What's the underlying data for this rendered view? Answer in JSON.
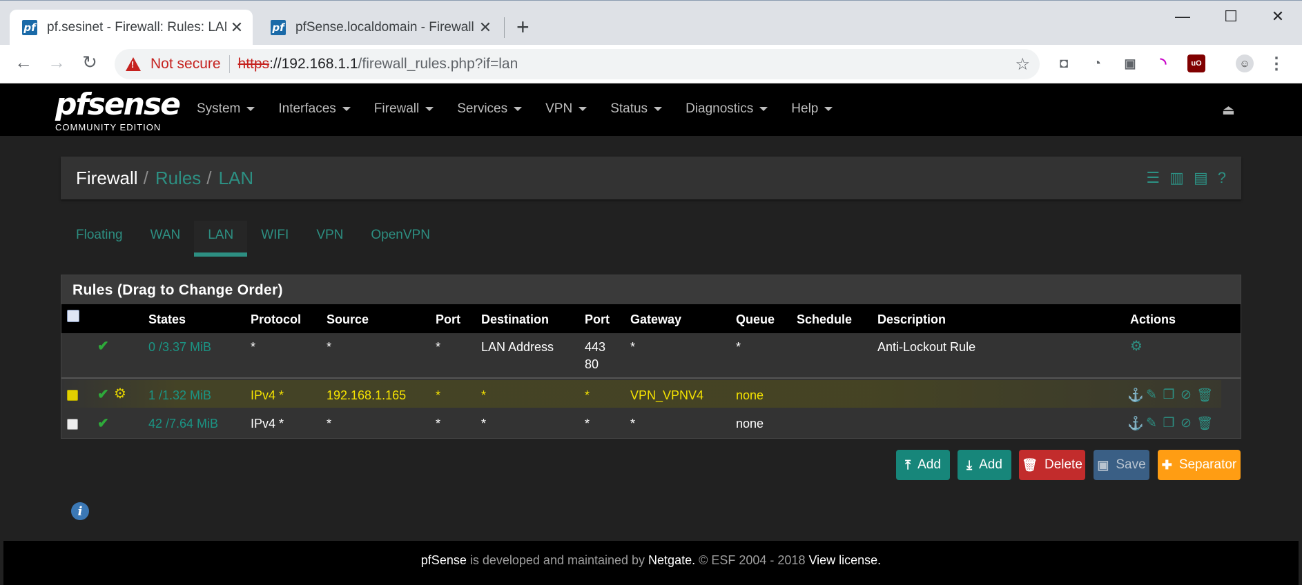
{
  "browser": {
    "tabs": [
      {
        "title": "pf.sesinet - Firewall: Rules: LAN",
        "favicon": "pf"
      },
      {
        "title": "pfSense.localdomain - Firewall: N",
        "favicon": "pf"
      }
    ],
    "new_tab": "+",
    "window": {
      "minimize": "—",
      "maximize": "☐",
      "close": "✕"
    },
    "nav": {
      "back": "←",
      "forward": "→",
      "reload": "↻"
    },
    "security_label": "Not secure",
    "url": {
      "scheme": "https",
      "host": "://192.168.1.1",
      "path": "/firewall_rules.php?if=lan"
    },
    "star": "☆",
    "menu": "⋮"
  },
  "pf_nav": {
    "logo": "pfsense",
    "logo_sub": "COMMUNITY EDITION",
    "items": [
      "System",
      "Interfaces",
      "Firewall",
      "Services",
      "VPN",
      "Status",
      "Diagnostics",
      "Help"
    ],
    "logout": "⏏"
  },
  "breadcrumb": {
    "root": "Firewall",
    "sep": "/",
    "level1": "Rules",
    "level2": "LAN"
  },
  "interface_tabs": [
    "Floating",
    "WAN",
    "LAN",
    "WIFI",
    "VPN",
    "OpenVPN"
  ],
  "rules_panel": {
    "title": "Rules (Drag to Change Order)",
    "headers": [
      "States",
      "Protocol",
      "Source",
      "Port",
      "Destination",
      "Port",
      "Gateway",
      "Queue",
      "Schedule",
      "Description",
      "Actions"
    ],
    "rows": [
      {
        "states": "0 /3.37 MiB",
        "protocol": "*",
        "source": "*",
        "sport": "*",
        "destination": "LAN Address",
        "dport_1": "443",
        "dport_2": "80",
        "gateway": "*",
        "queue": "*",
        "schedule": "",
        "description": "Anti-Lockout Rule"
      },
      {
        "states": "1 /1.32 MiB",
        "protocol": "IPv4 *",
        "source": "192.168.1.165",
        "sport": "*",
        "destination": "*",
        "dport_1": "*",
        "gateway": "VPN_VPNV4",
        "queue": "none",
        "schedule": "",
        "description": ""
      },
      {
        "states": "42 /7.64 MiB",
        "protocol": "IPv4 *",
        "source": "*",
        "sport": "*",
        "destination": "*",
        "dport_1": "*",
        "gateway": "*",
        "queue": "none",
        "schedule": "",
        "description": ""
      }
    ]
  },
  "buttons": {
    "add_top": "Add",
    "add_bottom": "Add",
    "delete": "Delete",
    "save": "Save",
    "separator": "Separator"
  },
  "footer": {
    "brand": "pfSense",
    "text1": " is developed and maintained by ",
    "company": "Netgate.",
    "text2": " © ESF 2004 - 2018 ",
    "license": "View license."
  },
  "colors": {
    "accent": "#2d8f82",
    "highlight": "#e1d000",
    "danger": "#c22c2c",
    "warning": "#ff9d13",
    "save": "#3a5f85"
  }
}
